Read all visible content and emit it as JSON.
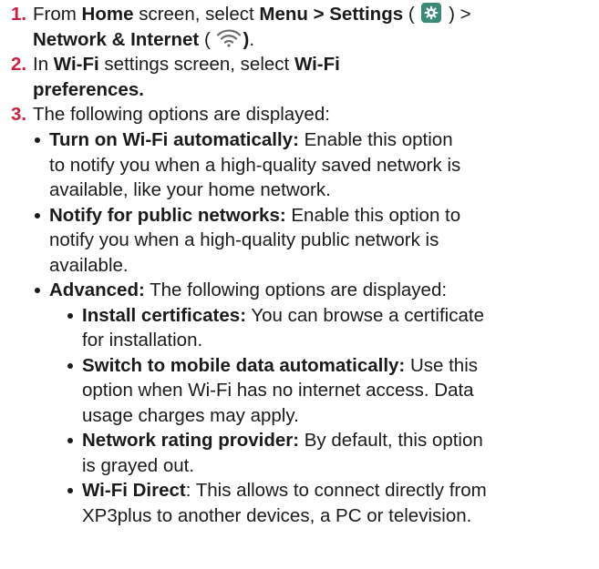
{
  "steps": [
    {
      "num": "1.",
      "t1": "From ",
      "b1": "Home",
      "t2": " screen, select ",
      "b2": "Menu > Settings",
      "t3": " (",
      "t4": ") >",
      "b3": "Network & Internet",
      "t5": " (",
      "b4": ")",
      "t6": ".",
      "settings_icon": "settings-gear-icon",
      "wifi_icon": "wifi-icon"
    },
    {
      "num": "2.",
      "t1": "In ",
      "b1": "Wi-Fi",
      "t2": " settings screen, select ",
      "b2": "Wi-Fi",
      "b3": "preferences."
    },
    {
      "num": "3.",
      "text": "The following options are displayed:"
    }
  ],
  "options": [
    {
      "label": "Turn on Wi-Fi automatically:",
      "line1": " Enable this option",
      "line2": "to notify you when a high-quality saved network is",
      "line3": "available, like your home network."
    },
    {
      "label": "Notify for public networks:",
      "line1": " Enable this option to",
      "line2": "notify you when a high-quality public network is",
      "line3": "available."
    },
    {
      "label": "Advanced:",
      "line1": " The following options are displayed:"
    }
  ],
  "advanced": [
    {
      "label": "Install certificates:",
      "line1": " You can browse a certificate",
      "line2": "for installation."
    },
    {
      "label": "Switch to mobile data automatically:",
      "line1": " Use this",
      "line2": "option when Wi-Fi has no internet access. Data",
      "line3": "usage charges may apply."
    },
    {
      "label": "Network rating provider:",
      "line1": " By default, this option",
      "line2": "is grayed out."
    },
    {
      "label": "Wi-Fi Direct",
      "line1": ": This allows to connect directly from",
      "line2": "XP3plus to another devices, a PC or television."
    }
  ],
  "colors": {
    "step_number": "#cc1f3d",
    "settings_icon_bg": "#3a8a78"
  }
}
